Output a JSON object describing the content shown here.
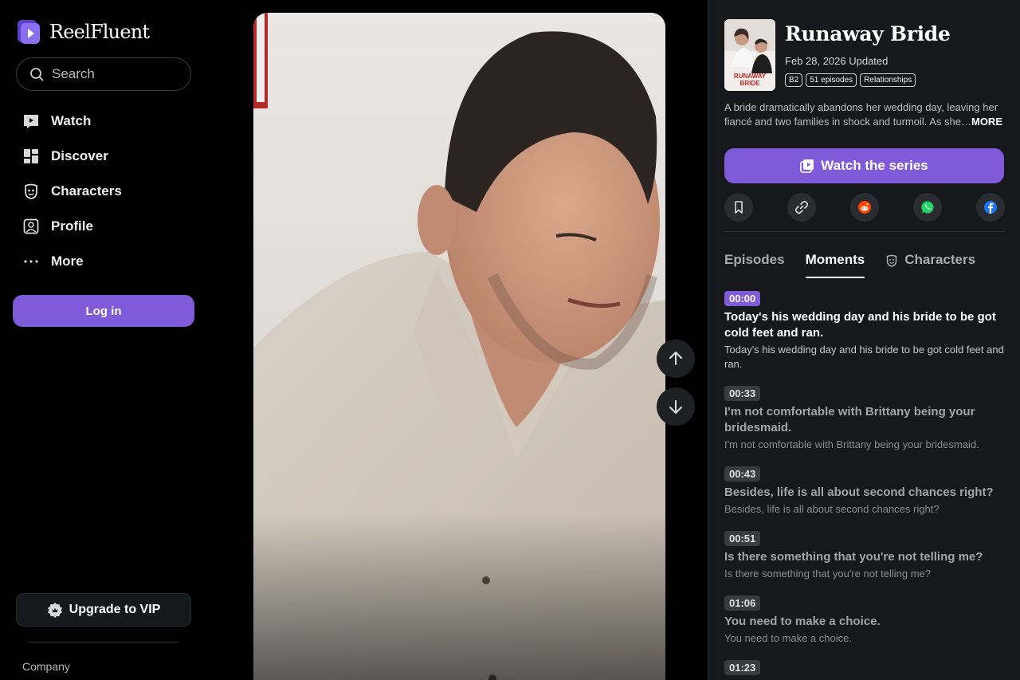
{
  "app": {
    "name": "ReelFluent"
  },
  "sidebar": {
    "search": {
      "placeholder": "Search"
    },
    "items": [
      {
        "label": "Watch",
        "icon": "play-square-icon"
      },
      {
        "label": "Discover",
        "icon": "grid-icon"
      },
      {
        "label": "Characters",
        "icon": "mask-icon"
      },
      {
        "label": "Profile",
        "icon": "user-icon"
      },
      {
        "label": "More",
        "icon": "ellipsis-icon"
      }
    ],
    "login_label": "Log in",
    "vip_label": "Upgrade to VIP",
    "company_label": "Company"
  },
  "series": {
    "title": "Runaway Bride",
    "updated": "Feb 28, 2026 Updated",
    "tags": [
      "B2",
      "51 episodes",
      "Relationships"
    ],
    "description": "A bride dramatically abandons her wedding day, leaving her fiancé and two families in shock and turmoil. As she…",
    "more_label": "MORE",
    "watch_label": "Watch the series",
    "poster_text": "RUNAWAY BRIDE"
  },
  "tabs": [
    {
      "label": "Episodes",
      "active": false
    },
    {
      "label": "Moments",
      "active": true
    },
    {
      "label": "Characters",
      "active": false
    }
  ],
  "moments": [
    {
      "time": "00:00",
      "title": "Today's his wedding day and his bride to be got cold feet and ran.",
      "subtitle": "Today's his wedding day and his bride to be got cold feet and ran.",
      "active": true
    },
    {
      "time": "00:33",
      "title": "I'm not comfortable with Brittany being your bridesmaid.",
      "subtitle": "I'm not comfortable with Brittany being your bridesmaid.",
      "active": false
    },
    {
      "time": "00:43",
      "title": "Besides, life is all about second chances right?",
      "subtitle": "Besides, life is all about second chances right?",
      "active": false
    },
    {
      "time": "00:51",
      "title": "Is there something that you're not telling me?",
      "subtitle": "Is there something that you're not telling me?",
      "active": false
    },
    {
      "time": "01:06",
      "title": "You need to make a choice.",
      "subtitle": "You need to make a choice.",
      "active": false
    },
    {
      "time": "01:23",
      "title": "",
      "subtitle": "",
      "active": false
    }
  ],
  "colors": {
    "accent": "#7f5ad9",
    "panel_bg": "#17181c",
    "page_bg": "#000000"
  }
}
